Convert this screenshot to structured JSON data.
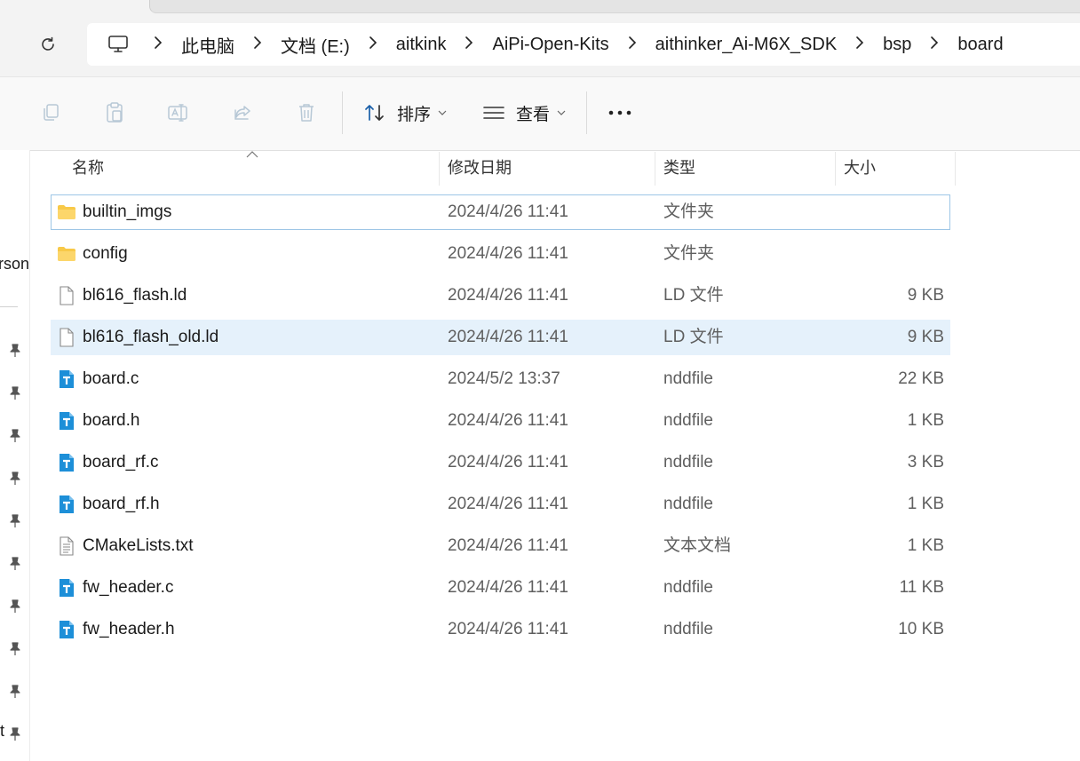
{
  "address_bar": {
    "crumbs": [
      "此电脑",
      "文档 (E:)",
      "aitkink",
      "AiPi-Open-Kits",
      "aithinker_Ai-M6X_SDK",
      "bsp",
      "board"
    ]
  },
  "toolbar": {
    "sort_label": "排序",
    "view_label": "查看"
  },
  "nav_pane": {
    "partial_text_1": "rson",
    "partial_text_2": "t"
  },
  "columns": {
    "name": "名称",
    "modified": "修改日期",
    "type": "类型",
    "size": "大小"
  },
  "files": [
    {
      "name": "builtin_imgs",
      "date": "2024/4/26 11:41",
      "type": "文件夹",
      "size": "",
      "icon": "folder-icon",
      "state": "selected"
    },
    {
      "name": "config",
      "date": "2024/4/26 11:41",
      "type": "文件夹",
      "size": "",
      "icon": "folder-icon",
      "state": ""
    },
    {
      "name": "bl616_flash.ld",
      "date": "2024/4/26 11:41",
      "type": "LD 文件",
      "size": "9 KB",
      "icon": "file-icon",
      "state": ""
    },
    {
      "name": "bl616_flash_old.ld",
      "date": "2024/4/26 11:41",
      "type": "LD 文件",
      "size": "9 KB",
      "icon": "file-icon",
      "state": "hover"
    },
    {
      "name": "board.c",
      "date": "2024/5/2 13:37",
      "type": "nddfile",
      "size": "22 KB",
      "icon": "text-editor-file-icon",
      "state": ""
    },
    {
      "name": "board.h",
      "date": "2024/4/26 11:41",
      "type": "nddfile",
      "size": "1 KB",
      "icon": "text-editor-file-icon",
      "state": ""
    },
    {
      "name": "board_rf.c",
      "date": "2024/4/26 11:41",
      "type": "nddfile",
      "size": "3 KB",
      "icon": "text-editor-file-icon",
      "state": ""
    },
    {
      "name": "board_rf.h",
      "date": "2024/4/26 11:41",
      "type": "nddfile",
      "size": "1 KB",
      "icon": "text-editor-file-icon",
      "state": ""
    },
    {
      "name": "CMakeLists.txt",
      "date": "2024/4/26 11:41",
      "type": "文本文档",
      "size": "1 KB",
      "icon": "text-document-icon",
      "state": ""
    },
    {
      "name": "fw_header.c",
      "date": "2024/4/26 11:41",
      "type": "nddfile",
      "size": "11 KB",
      "icon": "text-editor-file-icon",
      "state": ""
    },
    {
      "name": "fw_header.h",
      "date": "2024/4/26 11:41",
      "type": "nddfile",
      "size": "10 KB",
      "icon": "text-editor-file-icon",
      "state": ""
    }
  ],
  "colors": {
    "selection_border": "#9dc6e6",
    "hover_background": "#e5f1fb",
    "folder_yellow": "#f8c948",
    "editor_icon_blue": "#1d8fd8"
  }
}
